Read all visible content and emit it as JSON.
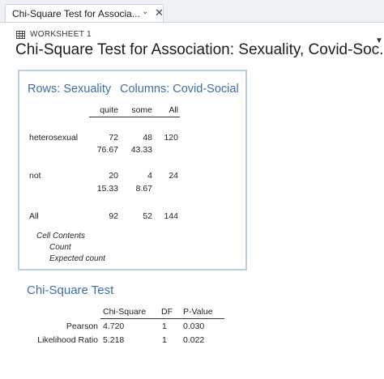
{
  "tab": {
    "label": "Chi-Square Test for Associa...",
    "chevron": "⌄",
    "close": "✕"
  },
  "worksheet": {
    "label": "WORKSHEET 1",
    "icon": "worksheet-grid-icon"
  },
  "title": "Chi-Square Test for Association: Sexuality, Covid-Soc...",
  "table": {
    "rows_header": "Rows: Sexuality",
    "cols_header": "Columns: Covid-Social",
    "col_headers": [
      "quite",
      "some",
      "All"
    ],
    "rows": [
      {
        "label": "heterosexual",
        "counts": [
          "72",
          "48",
          "120"
        ],
        "expected": [
          "76.67",
          "43.33"
        ]
      },
      {
        "label": "not",
        "counts": [
          "20",
          "4",
          "24"
        ],
        "expected": [
          "15.33",
          "8.67"
        ]
      },
      {
        "label": "All",
        "counts": [
          "92",
          "52",
          "144"
        ]
      }
    ],
    "cell_contents": {
      "title": "Cell Contents",
      "items": [
        "Count",
        "Expected count"
      ]
    }
  },
  "chi_test": {
    "title": "Chi-Square Test",
    "headers": [
      "Chi-Square",
      "DF",
      "P-Value"
    ],
    "rows": [
      {
        "label": "Pearson",
        "chi": "4.720",
        "df": "1",
        "p": "0.030"
      },
      {
        "label": "Likelihood Ratio",
        "chi": "5.218",
        "df": "1",
        "p": "0.022"
      }
    ]
  }
}
